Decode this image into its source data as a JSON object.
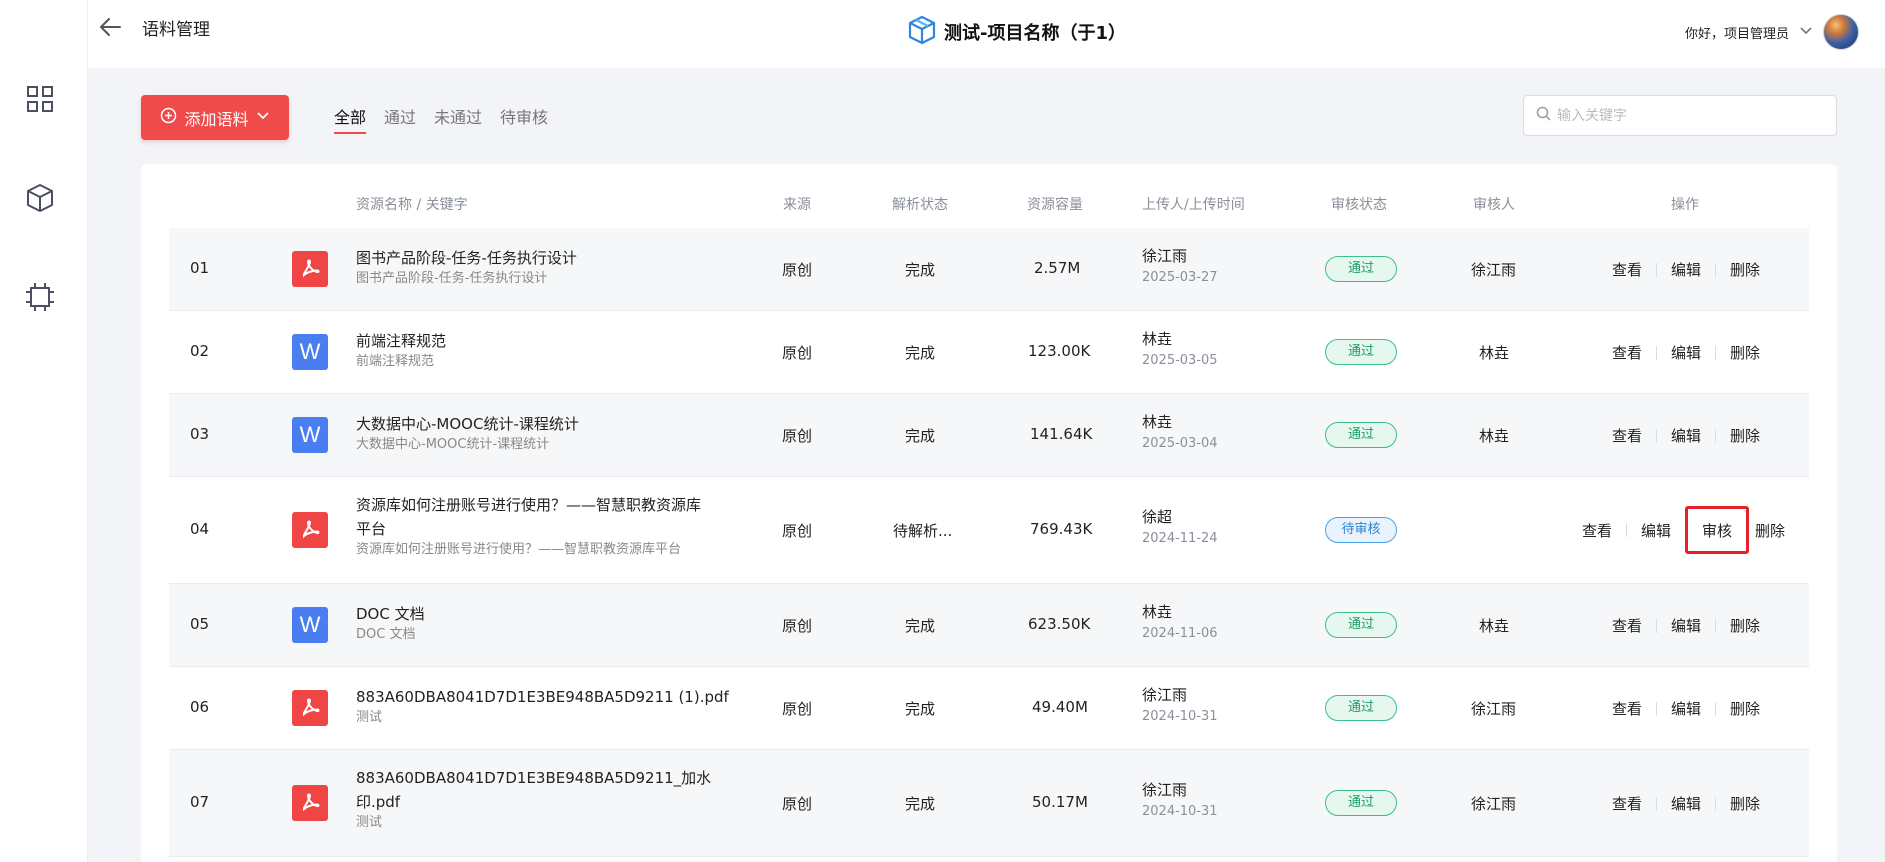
{
  "header": {
    "title": "语料管理",
    "project_name": "测试-项目名称（于1）",
    "greeting": "你好，项目管理员"
  },
  "toolbar": {
    "add_label": "添加语料",
    "tabs": [
      {
        "label": "全部",
        "active": true
      },
      {
        "label": "通过",
        "active": false
      },
      {
        "label": "未通过",
        "active": false
      },
      {
        "label": "待审核",
        "active": false
      }
    ],
    "search_placeholder": "输入关键字"
  },
  "table": {
    "headers": {
      "name": "资源名称 / 关键字",
      "source": "来源",
      "parse": "解析状态",
      "size": "资源容量",
      "uploader": "上传人/上传时间",
      "review": "审核状态",
      "reviewer": "审核人",
      "ops": "操作"
    },
    "ops_labels": {
      "view": "查看",
      "edit": "编辑",
      "review": "审核",
      "delete": "删除"
    },
    "rows": [
      {
        "num": "01",
        "type": "pdf",
        "name": "图书产品阶段-任务-任务执行设计",
        "keyword": "图书产品阶段-任务-任务执行设计",
        "source": "原创",
        "parse": "完成",
        "size": "2.57M",
        "uploader": "徐江雨",
        "date": "2025-03-27",
        "status": "通过",
        "reviewer": "徐江雨"
      },
      {
        "num": "02",
        "type": "doc",
        "name": "前端注释规范",
        "keyword": "前端注释规范",
        "source": "原创",
        "parse": "完成",
        "size": "123.00K",
        "uploader": "林垚",
        "date": "2025-03-05",
        "status": "通过",
        "reviewer": "林垚"
      },
      {
        "num": "03",
        "type": "doc",
        "name": "大数据中心-MOOC统计-课程统计",
        "keyword": "大数据中心-MOOC统计-课程统计",
        "source": "原创",
        "parse": "完成",
        "size": "141.64K",
        "uploader": "林垚",
        "date": "2025-03-04",
        "status": "通过",
        "reviewer": "林垚"
      },
      {
        "num": "04",
        "type": "pdf",
        "name_line1": "资源库如何注册账号进行使用？——智慧职教资源库",
        "name_line2": "平台",
        "keyword": "资源库如何注册账号进行使用？——智慧职教资源库平台",
        "source": "原创",
        "parse": "待解析...",
        "size": "769.43K",
        "uploader": "徐超",
        "date": "2024-11-24",
        "status": "待审核",
        "reviewer": ""
      },
      {
        "num": "05",
        "type": "doc",
        "name": "DOC 文档",
        "keyword": "DOC 文档",
        "source": "原创",
        "parse": "完成",
        "size": "623.50K",
        "uploader": "林垚",
        "date": "2024-11-06",
        "status": "通过",
        "reviewer": "林垚"
      },
      {
        "num": "06",
        "type": "pdf",
        "name": "883A60DBA8041D7D1E3BE948BA5D9211 (1).pdf",
        "keyword": "测试",
        "source": "原创",
        "parse": "完成",
        "size": "49.40M",
        "uploader": "徐江雨",
        "date": "2024-10-31",
        "status": "通过",
        "reviewer": "徐江雨"
      },
      {
        "num": "07",
        "type": "pdf",
        "name_line1": "883A60DBA8041D7D1E3BE948BA5D9211_加水",
        "name_line2": "印.pdf",
        "keyword": "测试",
        "source": "原创",
        "parse": "完成",
        "size": "50.17M",
        "uploader": "徐江雨",
        "date": "2024-10-31",
        "status": "通过",
        "reviewer": "徐江雨"
      }
    ]
  },
  "colors": {
    "accent": "#f04b4b",
    "pass": "#1e9b65",
    "pending": "#2a86d0",
    "highlight_box": "#e8202a"
  }
}
